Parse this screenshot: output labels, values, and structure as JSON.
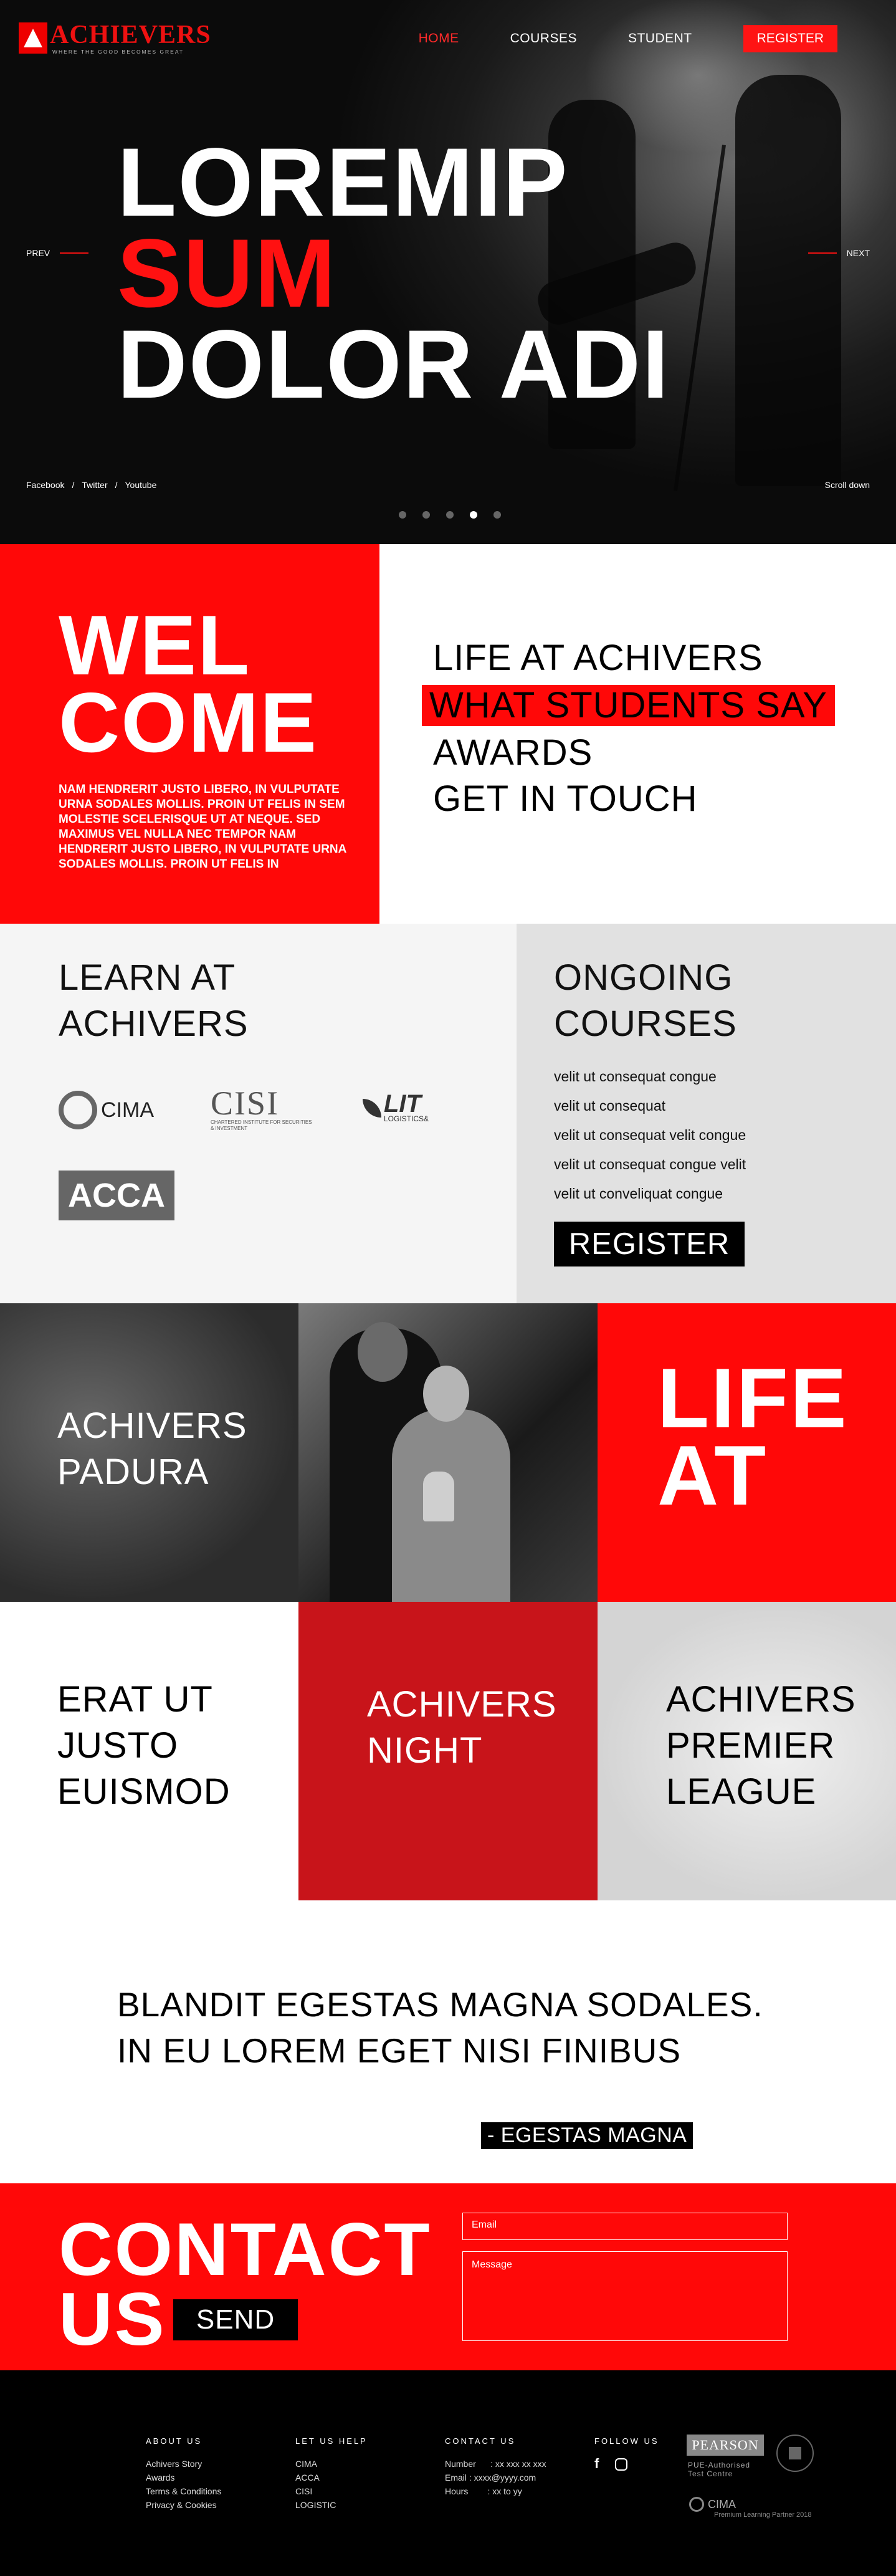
{
  "brand": {
    "name": "ACHIEVERS",
    "tagline": "WHERE THE GOOD BECOMES GREAT"
  },
  "nav": {
    "home": "HOME",
    "courses": "COURSES",
    "student": "STUDENT",
    "register": "REGISTER"
  },
  "hero": {
    "line1": "LOREMIP",
    "line2": "SUM",
    "line3": "DOLOR ADI",
    "prev": "PREV",
    "next": "NEXT",
    "socials": [
      "Facebook",
      "/",
      "Twitter",
      "/",
      "Youtube"
    ],
    "scroll": "Scroll down",
    "slides": 5,
    "active_slide": 4
  },
  "welcome": {
    "line1": "WEL",
    "line2": "COME",
    "text": "NAM HENDRERIT JUSTO LIBERO, IN VULPUTATE URNA SODALES MOLLIS. PROIN UT FELIS IN SEM MOLESTIE SCELERISQUE UT AT NEQUE. SED MAXIMUS VEL NULLA NEC TEMPOR NAM HENDRERIT JUSTO LIBERO, IN VULPUTATE URNA SODALES MOLLIS. PROIN UT FELIS IN"
  },
  "menu": [
    "LIFE AT ACHIVERS",
    "WHAT STUDENTS SAY",
    "AWARDS",
    "GET IN TOUCH"
  ],
  "learn": {
    "line1": "LEARN AT",
    "line2": "ACHIVERS",
    "logos": {
      "cima": "CIMA",
      "cisi": "CISI",
      "cisi_sub": "CHARTERED INSTITUTE FOR SECURITIES & INVESTMENT",
      "lit": "LIT",
      "lit_sub": "LOGISTICS&",
      "acca": "ACCA"
    }
  },
  "ongoing": {
    "line1": "ONGOING",
    "line2": "COURSES",
    "items": [
      "velit ut consequat congue",
      "velit ut consequat",
      "velit ut consequat velit congue",
      "velit ut consequat congue velit",
      "velit ut conveliquat congue"
    ],
    "register": "REGISTER"
  },
  "tiles": {
    "padura1": "ACHIVERS",
    "padura2": "PADURA",
    "life1": "LIFE",
    "life2": "AT",
    "erat1": "ERAT UT",
    "erat2": "JUSTO",
    "erat3": "EUISMOD",
    "night1": "ACHIVERS",
    "night2": "NIGHT",
    "league1": "ACHIVERS",
    "league2": "PREMIER",
    "league3": "LEAGUE"
  },
  "quote": {
    "text": "BLANDIT EGESTAS MAGNA SODALES. IN EU LOREM EGET NISI FINIBUS",
    "author": "- EGESTAS MAGNA"
  },
  "contact": {
    "line1": "CONTACT",
    "line2": "US",
    "send": "SEND",
    "email_placeholder": "Email",
    "message_placeholder": "Message"
  },
  "footer": {
    "about": {
      "title": "ABOUT US",
      "items": [
        "Achivers Story",
        "Awards",
        "Terms & Conditions",
        "Privacy & Cookies"
      ]
    },
    "help": {
      "title": "LET US HELP",
      "items": [
        "CIMA",
        "ACCA",
        "CISI",
        "LOGISTIC"
      ]
    },
    "contact": {
      "title": "CONTACT US",
      "items": [
        "Number      : xx xxx xx xxx",
        "Email : xxxx@yyyy.com",
        "Hours        : xx to yy"
      ]
    },
    "follow": {
      "title": "FOLLOW US",
      "icons": [
        "facebook-icon",
        "instagram-icon"
      ]
    },
    "pearson": "PEARSON",
    "pearson_sub1": "PUE-Authorised",
    "pearson_sub2": "Test Centre",
    "cima": "CIMA",
    "cima_sub": "Premium Learning Partner 2018"
  },
  "colors": {
    "accent": "#ff0808",
    "dark": "#000000",
    "light_panel": "#f5f5f5",
    "grey_panel": "#e1e1e1",
    "deep_red": "#c8141a"
  }
}
